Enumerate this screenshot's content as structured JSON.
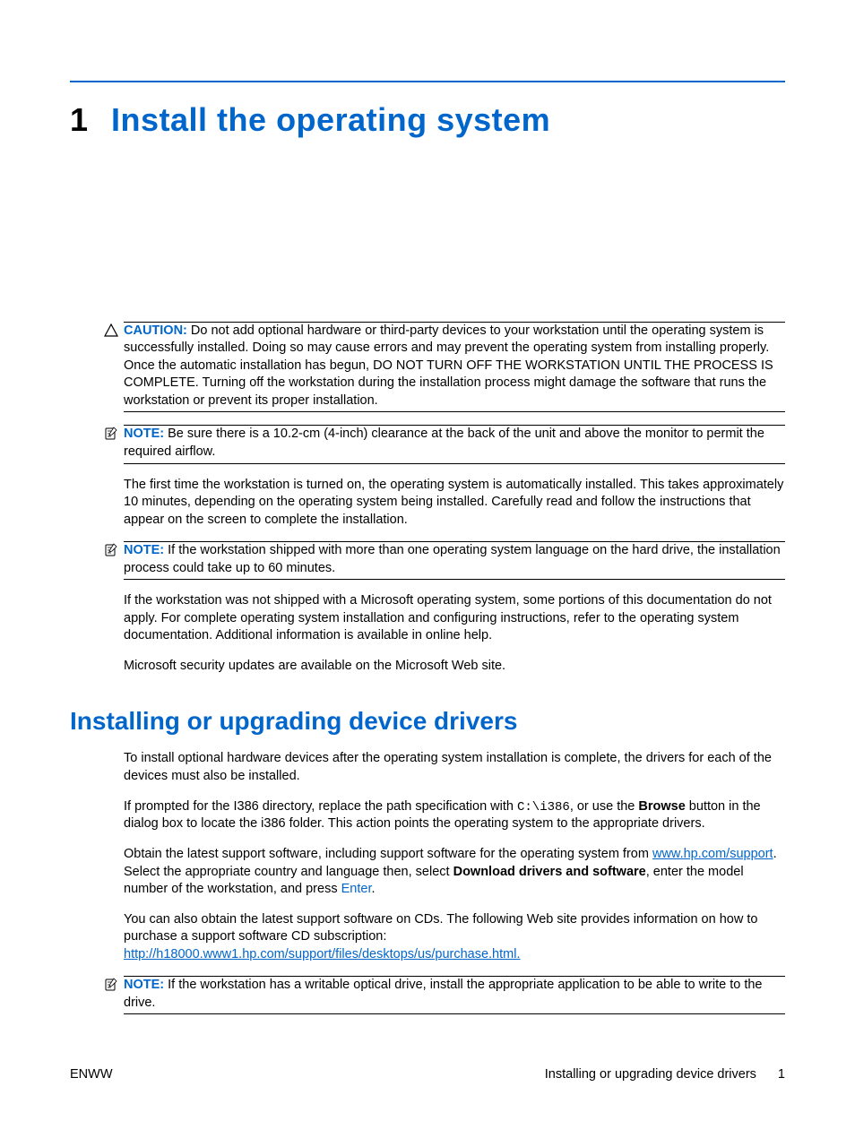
{
  "chapter": {
    "number": "1",
    "title": "Install the operating system"
  },
  "caution": {
    "label": "CAUTION:",
    "text": "Do not add optional hardware or third-party devices to your workstation until the operating system is successfully installed. Doing so may cause errors and may prevent the operating system from installing properly. Once the automatic installation has begun, DO NOT TURN OFF THE WORKSTATION UNTIL THE PROCESS IS COMPLETE. Turning off the workstation during the installation process might damage the software that runs the workstation or prevent its proper installation."
  },
  "note1": {
    "label": "NOTE:",
    "text": "Be sure there is a 10.2-cm (4-inch) clearance at the back of the unit and above the monitor to permit the required airflow."
  },
  "para1": "The first time the workstation is turned on, the operating system is automatically installed. This takes approximately 10 minutes, depending on the operating system being installed. Carefully read and follow the instructions that appear on the screen to complete the installation.",
  "note2": {
    "label": "NOTE:",
    "text": "If the workstation shipped with more than one operating system language on the hard drive, the installation process could take up to 60 minutes."
  },
  "para2": "If the workstation was not shipped with a Microsoft operating system, some portions of this documentation do not apply. For complete operating system installation and configuring instructions, refer to the operating system documentation. Additional information is available in online help.",
  "para3": "Microsoft security updates are available on the Microsoft Web site.",
  "section2": {
    "heading": "Installing or upgrading device drivers",
    "p1": "To install optional hardware devices after the operating system installation is complete, the drivers for each of the devices must also be installed.",
    "p2a": "If prompted for the I386 directory, replace the path specification with ",
    "p2code": "C:\\i386",
    "p2b": ", or use the ",
    "p2bold": "Browse",
    "p2c": " button in the dialog box to locate the i386 folder. This action points the operating system to the appropriate drivers.",
    "p3a": "Obtain the latest support software, including support software for the operating system from ",
    "p3link": "www.hp.com/support",
    "p3b": ". Select the appropriate country and language then, select ",
    "p3bold": "Download drivers and software",
    "p3c": ", enter the model number of the workstation, and press ",
    "p3enter": "Enter",
    "p3d": ".",
    "p4a": "You can also obtain the latest support software on CDs. The following Web site provides information on how to purchase a support software CD subscription: ",
    "p4link": "http://h18000.www1.hp.com/support/files/desktops/us/purchase.html."
  },
  "note3": {
    "label": "NOTE:",
    "text": "If the workstation has a writable optical drive, install the appropriate application to be able to write to the drive."
  },
  "footer": {
    "left": "ENWW",
    "right_text": "Installing or upgrading device drivers",
    "page": "1"
  }
}
